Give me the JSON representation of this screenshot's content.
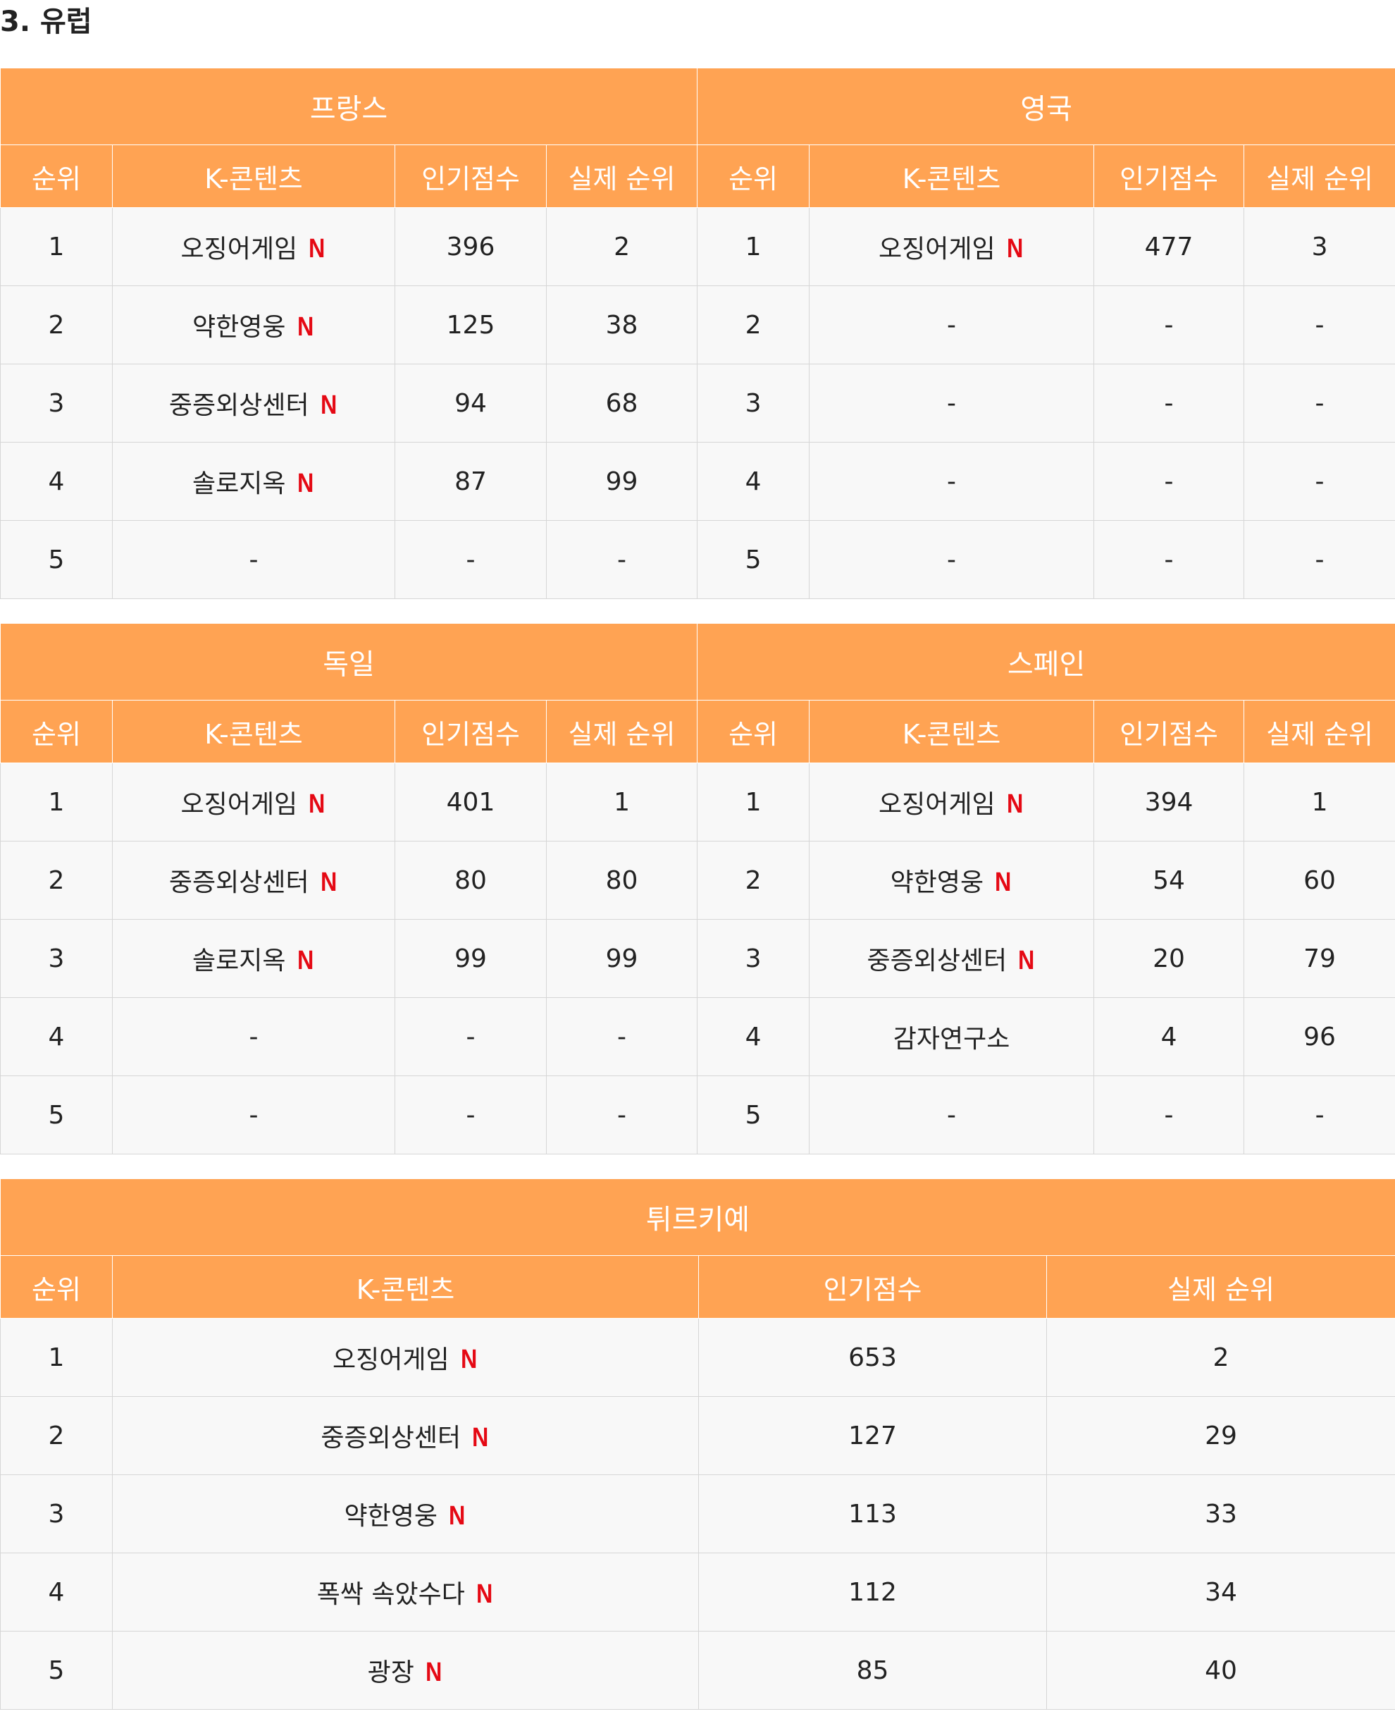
{
  "section_title": "3. 유럽",
  "netflix_mark": "N",
  "colors": {
    "header_bg": "#ffa353",
    "cell_bg": "#f8f8f8",
    "netflix_red": "#e50914"
  },
  "columns": {
    "rank": "순위",
    "content": "K-콘텐츠",
    "score": "인기점수",
    "actual": "실제 순위"
  },
  "tables": {
    "france": {
      "name": "프랑스",
      "rows": [
        {
          "rank": "1",
          "content": "오징어게임",
          "netflix": true,
          "score": "396",
          "actual": "2"
        },
        {
          "rank": "2",
          "content": "약한영웅",
          "netflix": true,
          "score": "125",
          "actual": "38"
        },
        {
          "rank": "3",
          "content": "중증외상센터",
          "netflix": true,
          "score": "94",
          "actual": "68"
        },
        {
          "rank": "4",
          "content": "솔로지옥",
          "netflix": true,
          "score": "87",
          "actual": "99"
        },
        {
          "rank": "5",
          "content": "-",
          "netflix": false,
          "score": "-",
          "actual": "-"
        }
      ]
    },
    "uk": {
      "name": "영국",
      "rows": [
        {
          "rank": "1",
          "content": "오징어게임",
          "netflix": true,
          "score": "477",
          "actual": "3"
        },
        {
          "rank": "2",
          "content": "-",
          "netflix": false,
          "score": "-",
          "actual": "-"
        },
        {
          "rank": "3",
          "content": "-",
          "netflix": false,
          "score": "-",
          "actual": "-"
        },
        {
          "rank": "4",
          "content": "-",
          "netflix": false,
          "score": "-",
          "actual": "-"
        },
        {
          "rank": "5",
          "content": "-",
          "netflix": false,
          "score": "-",
          "actual": "-"
        }
      ]
    },
    "germany": {
      "name": "독일",
      "rows": [
        {
          "rank": "1",
          "content": "오징어게임",
          "netflix": true,
          "score": "401",
          "actual": "1"
        },
        {
          "rank": "2",
          "content": "중증외상센터",
          "netflix": true,
          "score": "80",
          "actual": "80"
        },
        {
          "rank": "3",
          "content": "솔로지옥",
          "netflix": true,
          "score": "99",
          "actual": "99"
        },
        {
          "rank": "4",
          "content": "-",
          "netflix": false,
          "score": "-",
          "actual": "-"
        },
        {
          "rank": "5",
          "content": "-",
          "netflix": false,
          "score": "-",
          "actual": "-"
        }
      ]
    },
    "spain": {
      "name": "스페인",
      "rows": [
        {
          "rank": "1",
          "content": "오징어게임",
          "netflix": true,
          "score": "394",
          "actual": "1"
        },
        {
          "rank": "2",
          "content": "약한영웅",
          "netflix": true,
          "score": "54",
          "actual": "60"
        },
        {
          "rank": "3",
          "content": "중증외상센터",
          "netflix": true,
          "score": "20",
          "actual": "79"
        },
        {
          "rank": "4",
          "content": "감자연구소",
          "netflix": false,
          "score": "4",
          "actual": "96"
        },
        {
          "rank": "5",
          "content": "-",
          "netflix": false,
          "score": "-",
          "actual": "-"
        }
      ]
    },
    "turkiye": {
      "name": "튀르키예",
      "rows": [
        {
          "rank": "1",
          "content": "오징어게임",
          "netflix": true,
          "score": "653",
          "actual": "2"
        },
        {
          "rank": "2",
          "content": "중증외상센터",
          "netflix": true,
          "score": "127",
          "actual": "29"
        },
        {
          "rank": "3",
          "content": "약한영웅",
          "netflix": true,
          "score": "113",
          "actual": "33"
        },
        {
          "rank": "4",
          "content": "폭싹 속았수다",
          "netflix": true,
          "score": "112",
          "actual": "34"
        },
        {
          "rank": "5",
          "content": "광장",
          "netflix": true,
          "score": "85",
          "actual": "40"
        }
      ]
    }
  }
}
